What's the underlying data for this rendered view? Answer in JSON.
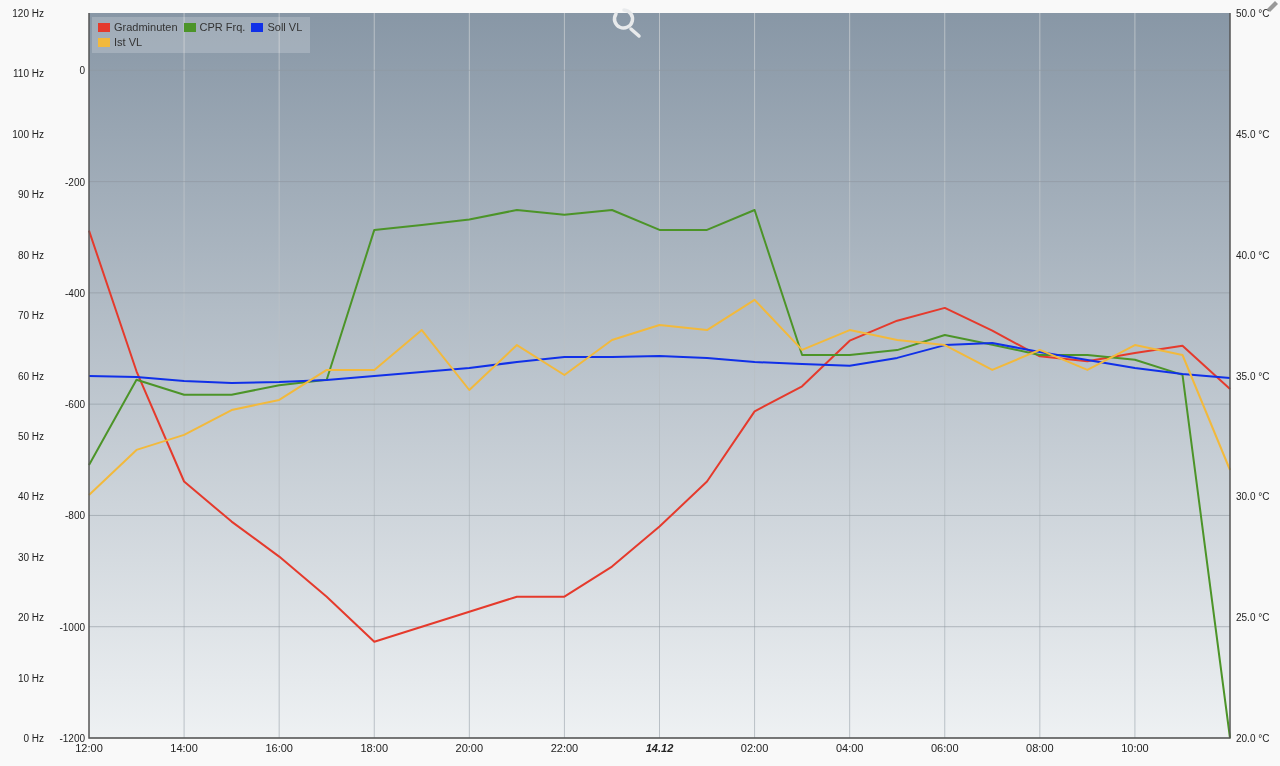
{
  "chart_data": {
    "type": "line",
    "grid": true,
    "ylim": [
      0,
      120
    ],
    "categories": [
      "12:00",
      null,
      "14:00",
      null,
      "16:00",
      null,
      "18:00",
      null,
      "20:00",
      null,
      "22:00",
      null,
      "14.12",
      null,
      "02:00",
      null,
      "04:00",
      null,
      "06:00",
      null,
      "08:00",
      null,
      "10:00",
      null,
      null
    ],
    "yticks": [
      {
        "value": 120,
        "label": "120 Hz"
      },
      {
        "value": 110,
        "label": "110 Hz"
      },
      {
        "value": 100,
        "label": "100 Hz"
      },
      {
        "value": 90,
        "label": "90 Hz"
      },
      {
        "value": 80,
        "label": "80 Hz"
      },
      {
        "value": 70,
        "label": "70 Hz"
      },
      {
        "value": 60,
        "label": "60 Hz"
      },
      {
        "value": 50,
        "label": "50 Hz"
      },
      {
        "value": 40,
        "label": "40 Hz"
      },
      {
        "value": 30,
        "label": "30 Hz"
      },
      {
        "value": 20,
        "label": "20 Hz"
      },
      {
        "value": 10,
        "label": "10 Hz"
      },
      {
        "value": 0,
        "label": "0 Hz"
      }
    ],
    "y2lim": [
      -1200,
      103
    ],
    "y2ticks": [
      {
        "value": 0,
        "label": "0"
      },
      {
        "value": -200,
        "label": "-200"
      },
      {
        "value": -400,
        "label": "-400"
      },
      {
        "value": -600,
        "label": "-600"
      },
      {
        "value": -800,
        "label": "-800"
      },
      {
        "value": -1000,
        "label": "-1000"
      },
      {
        "value": -1200,
        "label": "-1200"
      }
    ],
    "y3lim": [
      20,
      50
    ],
    "y3ticks": [
      {
        "value": 50,
        "label": "50.0 °C"
      },
      {
        "value": 45,
        "label": "45.0 °C"
      },
      {
        "value": 40,
        "label": "40.0 °C"
      },
      {
        "value": 35,
        "label": "35.0 °C"
      },
      {
        "value": 30,
        "label": "30.0 °C"
      },
      {
        "value": 25,
        "label": "25.0 °C"
      },
      {
        "value": 20,
        "label": "20.0 °C"
      }
    ],
    "series": [
      {
        "name": "Gradminuten",
        "color": "#e53a2c",
        "axis": "y2",
        "values": [
          -288,
          -541,
          -739,
          -811,
          -874,
          -946,
          -1027,
          -1000,
          -973,
          -946,
          -946,
          -892,
          -820,
          -739,
          -613,
          -568,
          -486,
          -450,
          -427,
          -468,
          -514,
          -523,
          -508,
          -495,
          -573
        ]
      },
      {
        "name": "CPR Frq.",
        "color": "#4c9428",
        "axis": "y",
        "values": [
          45.2,
          59.3,
          56.8,
          56.8,
          58.4,
          59.3,
          84.1,
          84.9,
          85.8,
          87.4,
          86.6,
          87.4,
          84.1,
          84.1,
          87.4,
          63.4,
          63.4,
          64.2,
          66.7,
          65.1,
          63.4,
          63.4,
          62.6,
          60.1,
          0
        ]
      },
      {
        "name": "Soll VL",
        "color": "#1030e8",
        "axis": "y3",
        "values": [
          34.98,
          34.94,
          34.77,
          34.69,
          34.73,
          34.82,
          34.98,
          35.15,
          35.31,
          35.56,
          35.77,
          35.77,
          35.81,
          35.73,
          35.56,
          35.48,
          35.4,
          35.73,
          36.26,
          36.35,
          35.97,
          35.64,
          35.31,
          35.06,
          34.9
        ]
      },
      {
        "name": "Ist VL",
        "color": "#f2b93c",
        "axis": "y3",
        "values": [
          30.06,
          31.92,
          32.54,
          33.57,
          33.99,
          35.23,
          35.23,
          36.88,
          34.4,
          36.26,
          35.02,
          36.47,
          37.09,
          36.88,
          38.13,
          36.06,
          36.88,
          36.47,
          36.26,
          35.23,
          36.06,
          35.23,
          36.26,
          35.85,
          31.09
        ]
      }
    ]
  }
}
